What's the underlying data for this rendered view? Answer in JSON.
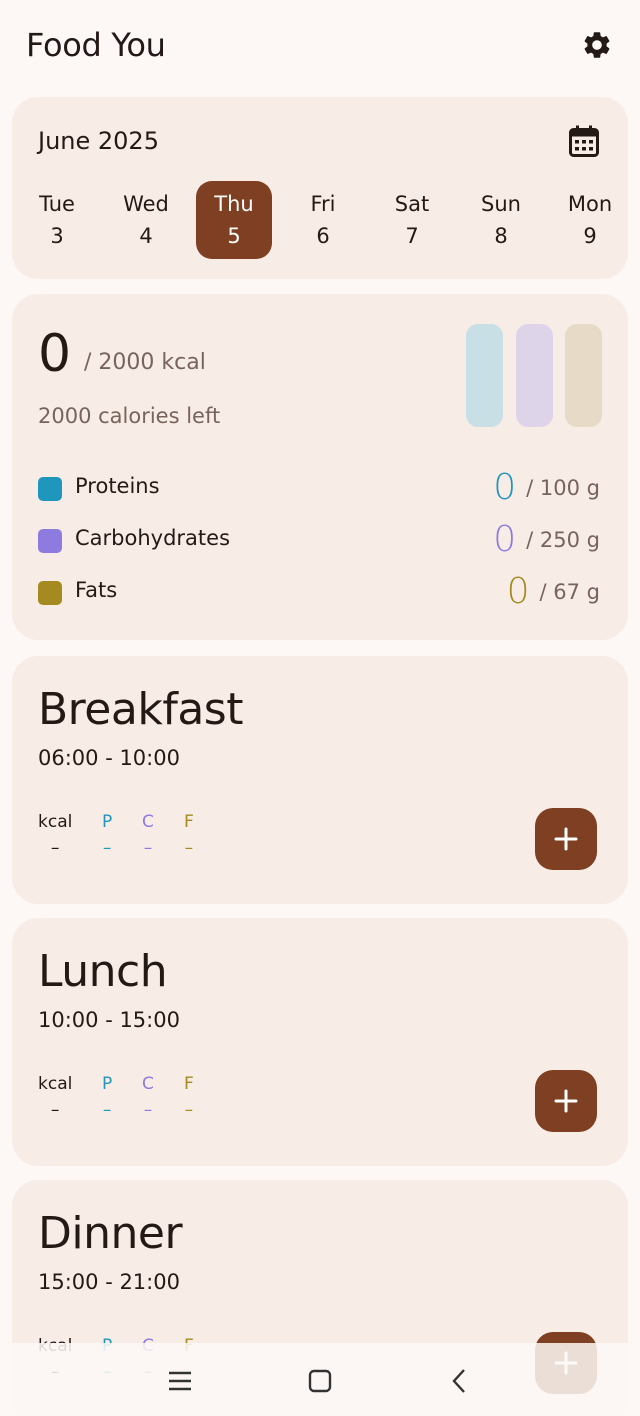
{
  "app": {
    "title": "Food You"
  },
  "calendar": {
    "month": "June 2025",
    "days": [
      {
        "weekday": "Tue",
        "date": "3",
        "selected": false
      },
      {
        "weekday": "Wed",
        "date": "4",
        "selected": false
      },
      {
        "weekday": "Thu",
        "date": "5",
        "selected": true
      },
      {
        "weekday": "Fri",
        "date": "6",
        "selected": false
      },
      {
        "weekday": "Sat",
        "date": "7",
        "selected": false
      },
      {
        "weekday": "Sun",
        "date": "8",
        "selected": false
      },
      {
        "weekday": "Mon",
        "date": "9",
        "selected": false
      }
    ]
  },
  "summary": {
    "kcal_value": "0",
    "kcal_goal": "/ 2000 kcal",
    "kcal_left": "2000 calories left",
    "macros": [
      {
        "name": "Proteins",
        "value": "0",
        "goal": "/ 100 g",
        "color": "#1f97bd"
      },
      {
        "name": "Carbohydrates",
        "value": "0",
        "goal": "/ 250 g",
        "color": "#8d7be0"
      },
      {
        "name": "Fats",
        "value": "0",
        "goal": "/ 67 g",
        "color": "#a58a21"
      }
    ],
    "bar_colors": [
      "#c9dfe6",
      "#ddd4ea",
      "#e7dac7"
    ],
    "bar_fill_fraction": [
      0,
      0,
      0
    ]
  },
  "nutrient_labels": {
    "kcal": "kcal",
    "p": "P",
    "c": "C",
    "f": "F",
    "empty": "–"
  },
  "meals": [
    {
      "name": "Breakfast",
      "time": "06:00 - 10:00"
    },
    {
      "name": "Lunch",
      "time": "10:00 - 15:00"
    },
    {
      "name": "Dinner",
      "time": "15:00 - 21:00"
    }
  ],
  "colors": {
    "accent": "#7e3f22",
    "card": "#f8ece7",
    "background": "#fdf8f6"
  },
  "icons": {
    "settings": "gear-icon",
    "calendar": "calendar-icon",
    "add": "plus-icon",
    "nav_menu": "menu-icon",
    "nav_home": "square-icon",
    "nav_back": "back-chevron-icon"
  }
}
